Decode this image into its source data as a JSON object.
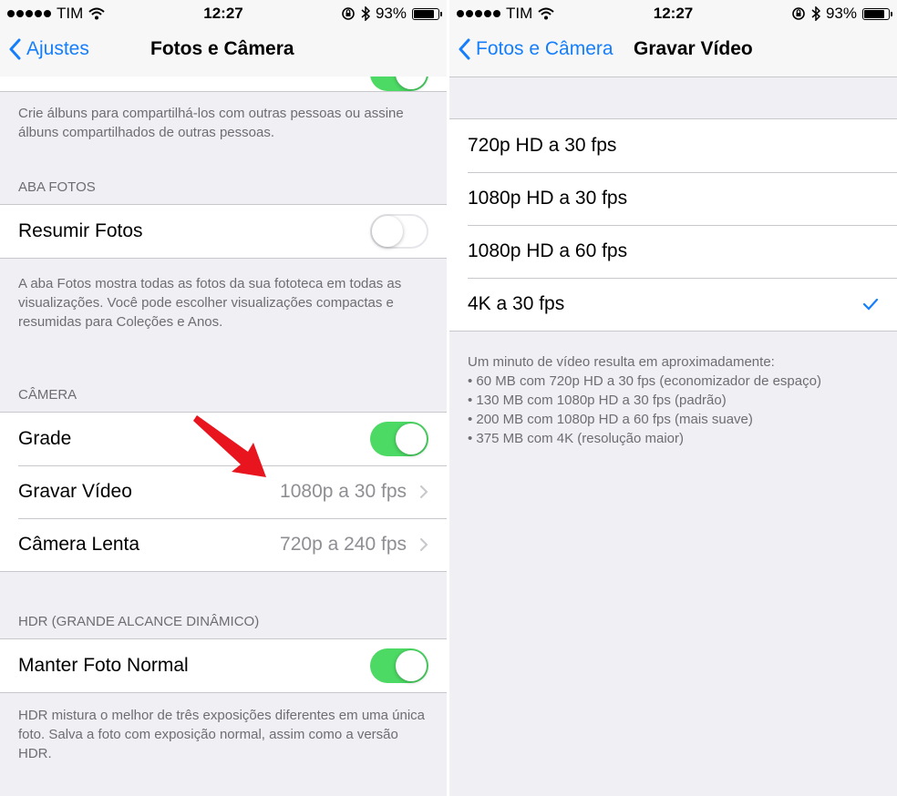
{
  "left": {
    "status": {
      "carrier": "TIM",
      "time": "12:27",
      "battery": "93%",
      "battery_level": 0.93
    },
    "nav": {
      "back": "Ajustes",
      "title": "Fotos e Câmera"
    },
    "shared_footer": "Crie álbuns para compartilhá-los com outras pessoas ou assine álbuns compartilhados de outras pessoas.",
    "photos_tab": {
      "header": "ABA FOTOS",
      "summarize_label": "Resumir Fotos",
      "summarize_on": false,
      "footer": "A aba Fotos mostra todas as fotos da sua fototeca em todas as visualizações. Você pode escolher visualizações compactas e resumidas para Coleções e Anos."
    },
    "camera": {
      "header": "CÂMERA",
      "grid_label": "Grade",
      "grid_on": true,
      "record_label": "Gravar Vídeo",
      "record_value": "1080p a 30 fps",
      "slowmo_label": "Câmera Lenta",
      "slowmo_value": "720p a 240 fps"
    },
    "hdr": {
      "header": "HDR (GRANDE ALCANCE DINÂMICO)",
      "keep_label": "Manter Foto Normal",
      "keep_on": true,
      "footer": "HDR mistura o melhor de três exposições diferentes em uma única foto. Salva a foto com exposição normal, assim como a versão HDR."
    }
  },
  "right": {
    "status": {
      "carrier": "TIM",
      "time": "12:27",
      "battery": "93%",
      "battery_level": 0.93
    },
    "nav": {
      "back": "Fotos e Câmera",
      "title": "Gravar Vídeo"
    },
    "options": [
      "720p HD a 30 fps",
      "1080p HD a 30 fps",
      "1080p HD a 60 fps",
      "4K a 30 fps"
    ],
    "selected_index": 3,
    "footer": "Um minuto de vídeo resulta em aproximadamente:\n• 60 MB com 720p HD a 30 fps (economizador de espaço)\n• 130 MB com 1080p HD a 30 fps (padrão)\n• 200 MB com 1080p HD a 60 fps (mais suave)\n• 375 MB com 4K (resolução maior)"
  },
  "colors": {
    "accent": "#147efb",
    "switch_on": "#4cd964",
    "arrow": "#e8141e",
    "background": "#efeff4"
  }
}
